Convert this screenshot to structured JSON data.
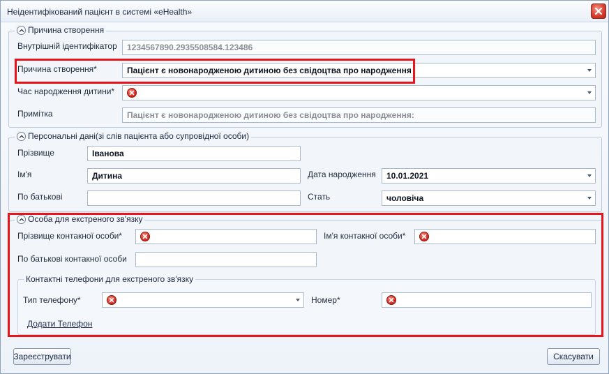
{
  "window": {
    "title": "Неідентифікований пацієнт в системі «eHealth»"
  },
  "creation_group": {
    "legend": "Причина створення",
    "internal_id_label": "Внутрішній ідентифікатор",
    "internal_id_value": "1234567890.2935508584.123486",
    "reason_label": "Причина створення*",
    "reason_value": "Пацієнт є новонародженою дитиною без свідоцтва про народження",
    "birth_time_label": "Час народження дитини*",
    "birth_time_value": "",
    "note_label": "Примітка",
    "note_value": "Пацієнт є новонародженою дитиною без свідоцтва про народження:"
  },
  "personal_group": {
    "legend": "Персональні дані(зі слів пацієнта або супровідної особи)",
    "surname_label": "Прізвище",
    "surname_value": "Іванова",
    "name_label": "Ім'я",
    "name_value": "Дитина",
    "patronymic_label": "По батькові",
    "patronymic_value": "",
    "dob_label": "Дата народження",
    "dob_value": "10.01.2021",
    "sex_label": "Стать",
    "sex_value": "чоловіча"
  },
  "emergency_group": {
    "legend": "Особа для екстреного зв'язку",
    "contact_surname_label": "Прізвище контакної особи*",
    "contact_name_label": "Ім'я контакної особи*",
    "contact_patronymic_label": "По батькові контакної особи",
    "phones": {
      "legend": "Контактні телефони для екстреного зв'язку",
      "type_label": "Тип телефону*",
      "number_label": "Номер*",
      "add_phone_link": "Додати Телефон"
    }
  },
  "footer": {
    "register_button": "Зареєструвати",
    "cancel_button": "Скасувати"
  },
  "colors": {
    "highlight": "#e8141b",
    "error_icon": "#d8231c",
    "border": "#a9b9cc"
  },
  "icons": {
    "close": "close-icon",
    "collapse": "chevron-up-icon",
    "error": "error-icon",
    "dropdown": "chevron-down-icon"
  }
}
